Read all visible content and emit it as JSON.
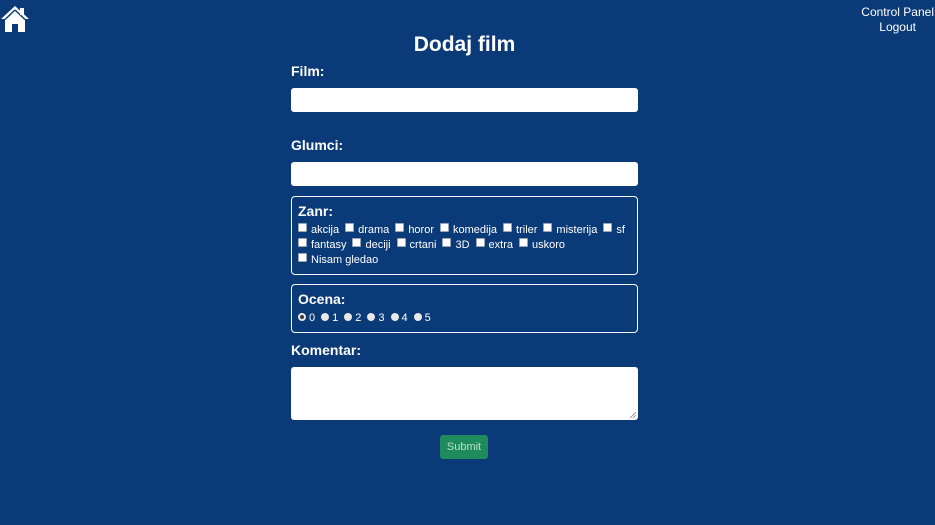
{
  "nav": {
    "home_icon": "home-icon",
    "control_panel": "Control Panel",
    "logout": "Logout"
  },
  "page": {
    "title": "Dodaj film"
  },
  "form": {
    "film_label": "Film:",
    "film_value": "",
    "glumci_label": "Glumci:",
    "glumci_value": "",
    "zanr_label": "Zanr:",
    "genres": [
      "akcija",
      "drama",
      "horor",
      "komedija",
      "triler",
      "misterija",
      "sf",
      "fantasy",
      "deciji",
      "crtani",
      "3D",
      "extra",
      "uskoro",
      "Nisam gledao"
    ],
    "ocena_label": "Ocena:",
    "ratings": [
      "0",
      "1",
      "2",
      "3",
      "4",
      "5"
    ],
    "rating_selected": "0",
    "komentar_label": "Komentar:",
    "komentar_value": "",
    "submit_label": "Submit"
  },
  "colors": {
    "background": "#0a3a78",
    "submit": "#1f8a5b"
  }
}
